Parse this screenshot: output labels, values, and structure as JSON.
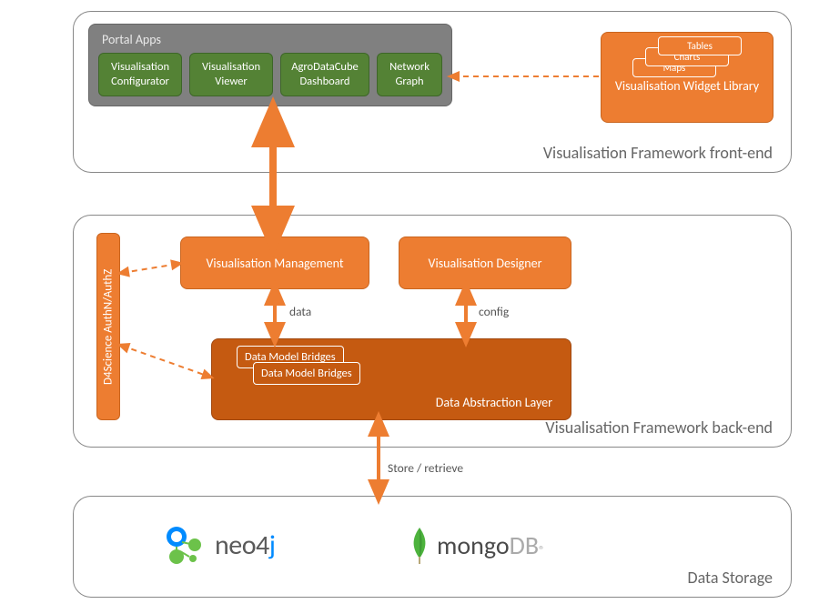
{
  "layers": {
    "frontend": "Visualisation Framework front-end",
    "backend": "Visualisation Framework back-end",
    "storage": "Data Storage"
  },
  "portal_apps": {
    "label": "Portal Apps",
    "items": [
      "Visualisation Configurator",
      "Visualisation Viewer",
      "AgroDataCube Dashboard",
      "Network Graph"
    ]
  },
  "widget_library": {
    "label": "Visualisation Widget Library",
    "cards": [
      "Maps",
      "Charts",
      "Tables"
    ]
  },
  "backend_boxes": {
    "vis_mgmt": "Visualisation Management",
    "vis_designer": "Visualisation Designer",
    "authz": "D4Science AuthN/AuthZ",
    "dal": "Data Abstraction Layer",
    "bridges": [
      "Data Model Bridges",
      "Data Model Bridges"
    ]
  },
  "labels": {
    "data": "data",
    "config": "config",
    "store": "Store / retrieve"
  },
  "logos": {
    "neo4j": "neo4j",
    "mongo_a": "mongo",
    "mongo_b": "DB"
  },
  "colors": {
    "orange": "#ED7D31",
    "dark_orange": "#C55A11",
    "green": "#548235",
    "gray": "#808080"
  }
}
